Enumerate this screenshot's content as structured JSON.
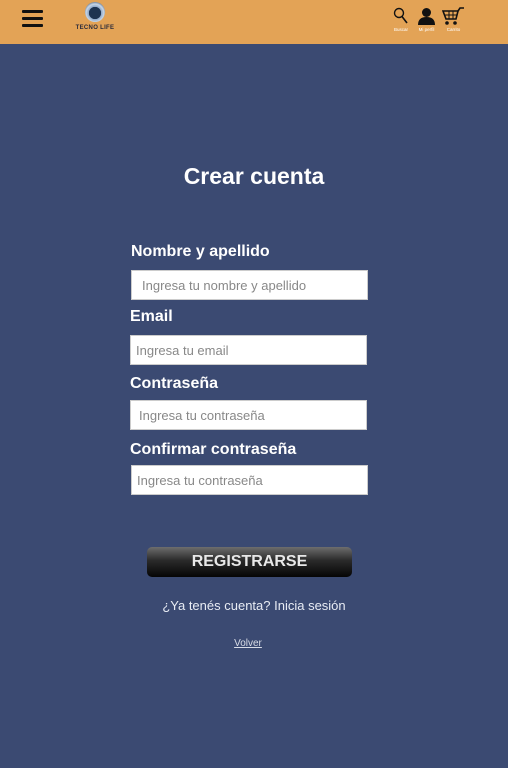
{
  "header": {
    "logo_text": "TECNO LIFE",
    "icons": [
      {
        "name": "search-icon",
        "label": "Buscar"
      },
      {
        "name": "user-icon",
        "label": "Mi perfil"
      },
      {
        "name": "cart-icon",
        "label": "Carrito"
      }
    ]
  },
  "form": {
    "title": "Crear cuenta",
    "fields": [
      {
        "label": "Nombre y apellido",
        "placeholder": "Ingresa tu nombre y apellido"
      },
      {
        "label": "Email",
        "placeholder": "Ingresa tu email"
      },
      {
        "label": "Contraseña",
        "placeholder": "Ingresa tu contraseña"
      },
      {
        "label": "Confirmar contraseña",
        "placeholder": "Ingresa tu contraseña"
      }
    ],
    "submit_label": "REGISTRARSE",
    "login_link": "¿Ya tenés cuenta? Inicia sesión",
    "back_link": "Volver"
  },
  "colors": {
    "header": "#e3a356",
    "background": "#3b4a72"
  }
}
